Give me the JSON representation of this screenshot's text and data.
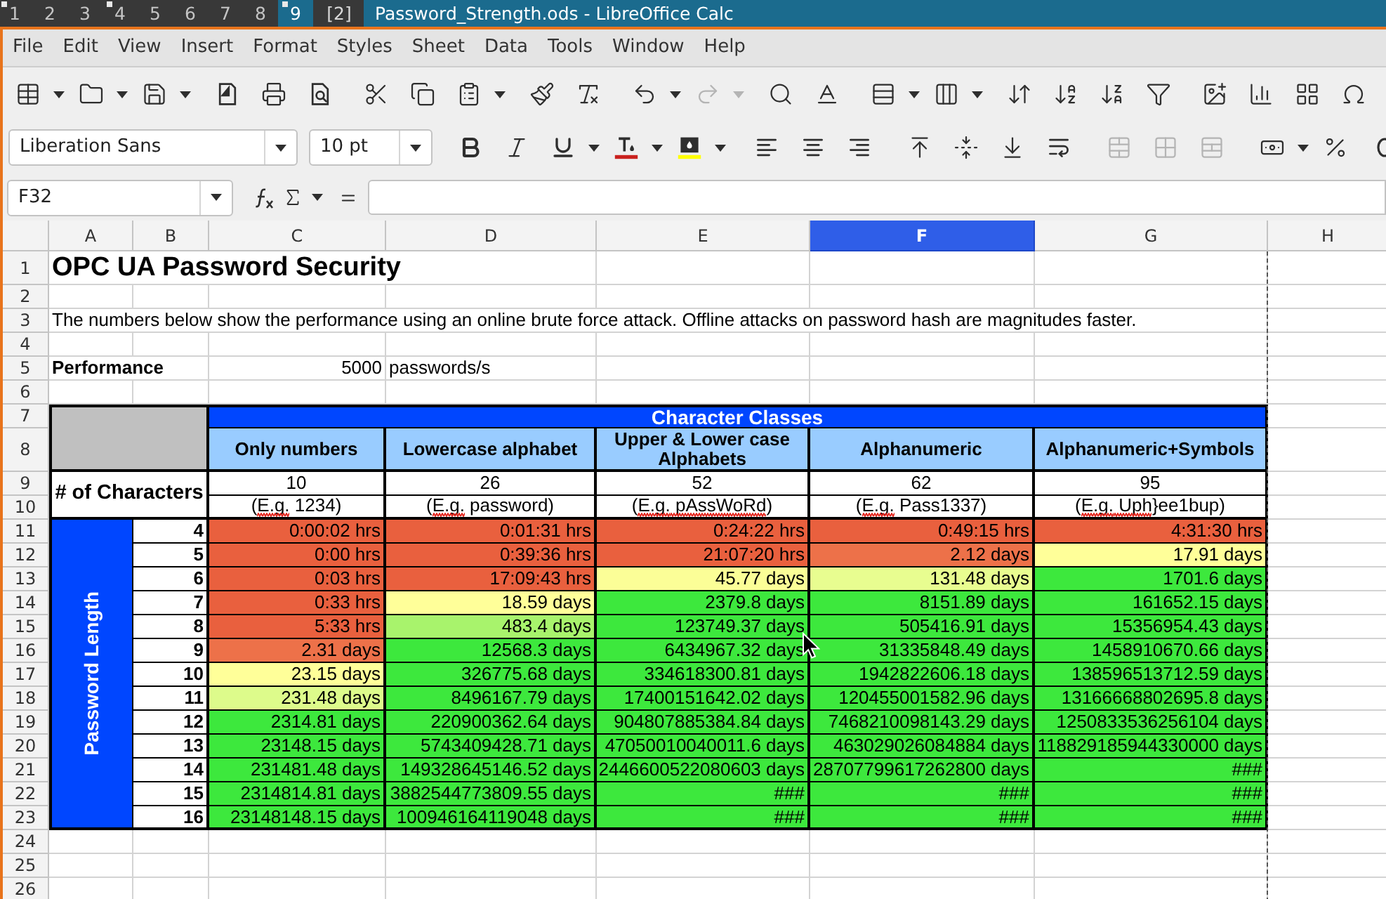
{
  "desktop_bar": {
    "workspaces": [
      {
        "label": "1",
        "selected": false,
        "occupied": true
      },
      {
        "label": "2",
        "selected": false,
        "occupied": false
      },
      {
        "label": "3",
        "selected": false,
        "occupied": false
      },
      {
        "label": "4",
        "selected": false,
        "occupied": true
      },
      {
        "label": "5",
        "selected": false,
        "occupied": false
      },
      {
        "label": "6",
        "selected": false,
        "occupied": false
      },
      {
        "label": "7",
        "selected": false,
        "occupied": false
      },
      {
        "label": "8",
        "selected": false,
        "occupied": false
      },
      {
        "label": "9",
        "selected": true,
        "occupied": true
      }
    ],
    "status": "[2]",
    "window_title": "Password_Strength.ods - LibreOffice Calc"
  },
  "menu": [
    "File",
    "Edit",
    "View",
    "Insert",
    "Format",
    "Styles",
    "Sheet",
    "Data",
    "Tools",
    "Window",
    "Help"
  ],
  "standard_toolbar": [
    [
      {
        "kind": "table",
        "dropdown": true,
        "disabled": false
      },
      {
        "kind": "folder",
        "dropdown": true,
        "disabled": false
      },
      {
        "kind": "save",
        "dropdown": true,
        "disabled": false
      }
    ],
    [
      {
        "kind": "export",
        "dropdown": false,
        "disabled": false
      },
      {
        "kind": "printer",
        "dropdown": false,
        "disabled": false
      },
      {
        "kind": "preview",
        "dropdown": false,
        "disabled": false
      }
    ],
    [
      {
        "kind": "cut",
        "dropdown": false,
        "disabled": false
      },
      {
        "kind": "copy",
        "dropdown": false,
        "disabled": false
      },
      {
        "kind": "paste",
        "dropdown": true,
        "disabled": false
      }
    ],
    [
      {
        "kind": "brush",
        "dropdown": false,
        "disabled": false
      },
      {
        "kind": "unformat",
        "dropdown": false,
        "disabled": false
      }
    ],
    [
      {
        "kind": "undo",
        "dropdown": true,
        "disabled": false
      },
      {
        "kind": "redo",
        "dropdown": true,
        "disabled": true
      }
    ],
    [
      {
        "kind": "find",
        "dropdown": false,
        "disabled": false
      },
      {
        "kind": "spelling",
        "dropdown": false,
        "disabled": false
      }
    ],
    [
      {
        "kind": "rows",
        "dropdown": true,
        "disabled": false
      },
      {
        "kind": "columns",
        "dropdown": true,
        "disabled": false
      }
    ],
    [
      {
        "kind": "sort",
        "dropdown": false,
        "disabled": false
      },
      {
        "kind": "ascending",
        "dropdown": false,
        "disabled": false
      },
      {
        "kind": "descending",
        "dropdown": false,
        "disabled": false
      },
      {
        "kind": "filter",
        "dropdown": false,
        "disabled": false
      }
    ],
    [
      {
        "kind": "image",
        "dropdown": false,
        "disabled": false
      },
      {
        "kind": "chart",
        "dropdown": false,
        "disabled": false
      },
      {
        "kind": "pivot",
        "dropdown": false,
        "disabled": false
      },
      {
        "kind": "symbol",
        "dropdown": false,
        "disabled": false
      }
    ]
  ],
  "formatting_toolbar": {
    "font_name": "Liberation Sans",
    "font_size": "10 pt",
    "groups": [
      [
        {
          "kind": "bold",
          "dropdown": false,
          "disabled": false
        },
        {
          "kind": "italic",
          "dropdown": false,
          "disabled": false
        },
        {
          "kind": "underline",
          "dropdown": true,
          "disabled": false
        },
        {
          "kind": "fontcolor",
          "dropdown": true,
          "disabled": false
        },
        {
          "kind": "highlight",
          "dropdown": true,
          "disabled": false
        }
      ],
      [
        {
          "kind": "left",
          "dropdown": false,
          "disabled": false
        },
        {
          "kind": "center",
          "dropdown": false,
          "disabled": false
        },
        {
          "kind": "right",
          "dropdown": false,
          "disabled": false
        }
      ],
      [
        {
          "kind": "top",
          "dropdown": false,
          "disabled": false
        },
        {
          "kind": "middle",
          "dropdown": false,
          "disabled": false
        },
        {
          "kind": "bottom",
          "dropdown": false,
          "disabled": false
        },
        {
          "kind": "wrap",
          "dropdown": false,
          "disabled": false
        }
      ],
      [
        {
          "kind": "merge",
          "dropdown": false,
          "disabled": true
        },
        {
          "kind": "mergecenter",
          "dropdown": false,
          "disabled": true
        },
        {
          "kind": "unmerge",
          "dropdown": false,
          "disabled": true
        }
      ],
      [
        {
          "kind": "currency",
          "dropdown": true,
          "disabled": false
        },
        {
          "kind": "percent",
          "dropdown": false,
          "disabled": false
        },
        {
          "kind": "decimal",
          "dropdown": false,
          "disabled": false
        }
      ]
    ]
  },
  "formula_bar": {
    "name_box": "F32"
  },
  "sheet": {
    "columns": [
      {
        "label": "A",
        "selected": false
      },
      {
        "label": "B",
        "selected": false
      },
      {
        "label": "C",
        "selected": false
      },
      {
        "label": "D",
        "selected": false
      },
      {
        "label": "E",
        "selected": false
      },
      {
        "label": "F",
        "selected": true
      },
      {
        "label": "G",
        "selected": false
      },
      {
        "label": "H",
        "selected": false
      }
    ],
    "rows": [
      "1",
      "2",
      "3",
      "4",
      "5",
      "6",
      "7",
      "8",
      "9",
      "10",
      "11",
      "12",
      "13",
      "14",
      "15",
      "16",
      "17",
      "18",
      "19",
      "20",
      "21",
      "22",
      "23",
      "24",
      "25",
      "26"
    ],
    "title": "OPC UA Password Security",
    "note": "The numbers below show the performance using an online brute force attack. Offline attacks on password hash are magnitudes faster.",
    "performance": {
      "label": "Performance",
      "value": "5000",
      "unit": "passwords/s"
    },
    "table": {
      "group_header": "Character Classes",
      "row_heading": "# of Characters",
      "side_label": "Password Length",
      "classes": [
        {
          "name": "Only numbers",
          "count": "10",
          "example": [
            {
              "text": "(",
              "misspelled": false
            },
            {
              "text": "E.g.",
              "misspelled": true
            },
            {
              "text": " 1234)",
              "misspelled": false
            }
          ]
        },
        {
          "name": "Lowercase alphabet",
          "count": "26",
          "example": [
            {
              "text": "(",
              "misspelled": false
            },
            {
              "text": "E.g.",
              "misspelled": true
            },
            {
              "text": " password)",
              "misspelled": false
            }
          ]
        },
        {
          "name": "Upper & Lower case Alphabets",
          "count": "52",
          "example": [
            {
              "text": "(",
              "misspelled": false
            },
            {
              "text": "E.g.",
              "misspelled": true
            },
            {
              "text": " pAssWoRd",
              "misspelled": true
            },
            {
              "text": ")",
              "misspelled": false
            }
          ]
        },
        {
          "name": "Alphanumeric",
          "count": "62",
          "example": [
            {
              "text": "(",
              "misspelled": false
            },
            {
              "text": "E.g.",
              "misspelled": true
            },
            {
              "text": " Pass1337)",
              "misspelled": false
            }
          ]
        },
        {
          "name": "Alphanumeric+Symbols",
          "count": "95",
          "example": [
            {
              "text": "(",
              "misspelled": false
            },
            {
              "text": "E.g.",
              "misspelled": true
            },
            {
              "text": " Uph",
              "misspelled": true
            },
            {
              "text": "}ee1bup)",
              "misspelled": false
            }
          ]
        }
      ],
      "rows": [
        {
          "length": "4",
          "cells": [
            {
              "text": "0:00:02 hrs",
              "color": "#e9603e"
            },
            {
              "text": "0:01:31 hrs",
              "color": "#e9603e"
            },
            {
              "text": "0:24:22 hrs",
              "color": "#e9603e"
            },
            {
              "text": "0:49:15 hrs",
              "color": "#e9603e"
            },
            {
              "text": "4:31:30 hrs",
              "color": "#e9603e"
            }
          ]
        },
        {
          "length": "5",
          "cells": [
            {
              "text": "0:00 hrs",
              "color": "#e9603e"
            },
            {
              "text": "0:39:36 hrs",
              "color": "#e9603e"
            },
            {
              "text": "21:07:20 hrs",
              "color": "#e9603e"
            },
            {
              "text": "2.12 days",
              "color": "#ed7149"
            },
            {
              "text": "17.91 days",
              "color": "#ffff99"
            }
          ]
        },
        {
          "length": "6",
          "cells": [
            {
              "text": "0:03 hrs",
              "color": "#e9603e"
            },
            {
              "text": "17:09:43 hrs",
              "color": "#e9603e"
            },
            {
              "text": "45.77 days",
              "color": "#fbfe97"
            },
            {
              "text": "131.48 days",
              "color": "#e8fd90"
            },
            {
              "text": "1701.6 days",
              "color": "#3de83d"
            }
          ]
        },
        {
          "length": "7",
          "cells": [
            {
              "text": "0:33 hrs",
              "color": "#e9603e"
            },
            {
              "text": "18.59 days",
              "color": "#ffff99"
            },
            {
              "text": "2379.8 days",
              "color": "#3de83d"
            },
            {
              "text": "8151.89 days",
              "color": "#3de83d"
            },
            {
              "text": "161652.15 days",
              "color": "#3de83d"
            }
          ]
        },
        {
          "length": "8",
          "cells": [
            {
              "text": "5:33 hrs",
              "color": "#e9603e"
            },
            {
              "text": "483.4 days",
              "color": "#a8f36c"
            },
            {
              "text": "123749.37 days",
              "color": "#3de83d"
            },
            {
              "text": "505416.91 days",
              "color": "#3de83d"
            },
            {
              "text": "15356954.43 days",
              "color": "#3de83d"
            }
          ]
        },
        {
          "length": "9",
          "cells": [
            {
              "text": "2.31 days",
              "color": "#ed7149"
            },
            {
              "text": "12568.3 days",
              "color": "#3de83d"
            },
            {
              "text": "6434967.32 days",
              "color": "#3de83d"
            },
            {
              "text": "31335848.49 days",
              "color": "#3de83d"
            },
            {
              "text": "1458910670.66 days",
              "color": "#3de83d"
            }
          ]
        },
        {
          "length": "10",
          "cells": [
            {
              "text": "23.15 days",
              "color": "#ffff99"
            },
            {
              "text": "326775.68 days",
              "color": "#3de83d"
            },
            {
              "text": "334618300.81 days",
              "color": "#3de83d"
            },
            {
              "text": "1942822606.18 days",
              "color": "#3de83d"
            },
            {
              "text": "138596513712.59 days",
              "color": "#3de83d"
            }
          ]
        },
        {
          "length": "11",
          "cells": [
            {
              "text": "231.48 days",
              "color": "#ddfb8b"
            },
            {
              "text": "8496167.79 days",
              "color": "#3de83d"
            },
            {
              "text": "17400151642.02 days",
              "color": "#3de83d"
            },
            {
              "text": "120455001582.96 days",
              "color": "#3de83d"
            },
            {
              "text": "13166668802695.8 days",
              "color": "#3de83d"
            }
          ]
        },
        {
          "length": "12",
          "cells": [
            {
              "text": "2314.81 days",
              "color": "#3de83d"
            },
            {
              "text": "220900362.64 days",
              "color": "#3de83d"
            },
            {
              "text": "904807885384.84 days",
              "color": "#3de83d"
            },
            {
              "text": "7468210098143.29 days",
              "color": "#3de83d"
            },
            {
              "text": "1250833536256104 days",
              "color": "#3de83d"
            }
          ]
        },
        {
          "length": "13",
          "cells": [
            {
              "text": "23148.15 days",
              "color": "#3de83d"
            },
            {
              "text": "5743409428.71 days",
              "color": "#3de83d"
            },
            {
              "text": "47050010040011.6 days",
              "color": "#3de83d"
            },
            {
              "text": "463029026084884 days",
              "color": "#3de83d"
            },
            {
              "text": "118829185944330000 days",
              "color": "#3de83d"
            }
          ]
        },
        {
          "length": "14",
          "cells": [
            {
              "text": "231481.48 days",
              "color": "#3de83d"
            },
            {
              "text": "149328645146.52 days",
              "color": "#3de83d"
            },
            {
              "text": "2446600522080603 days",
              "color": "#3de83d"
            },
            {
              "text": "28707799617262800 days",
              "color": "#3de83d"
            },
            {
              "text": "###",
              "color": "#3de83d"
            }
          ]
        },
        {
          "length": "15",
          "cells": [
            {
              "text": "2314814.81 days",
              "color": "#3de83d"
            },
            {
              "text": "3882544773809.55 days",
              "color": "#3de83d"
            },
            {
              "text": "###",
              "color": "#3de83d"
            },
            {
              "text": "###",
              "color": "#3de83d"
            },
            {
              "text": "###",
              "color": "#3de83d"
            }
          ]
        },
        {
          "length": "16",
          "cells": [
            {
              "text": "23148148.15 days",
              "color": "#3de83d"
            },
            {
              "text": "100946164119048 days",
              "color": "#3de83d"
            },
            {
              "text": "###",
              "color": "#3de83d"
            },
            {
              "text": "###",
              "color": "#3de83d"
            },
            {
              "text": "###",
              "color": "#3de83d"
            }
          ]
        }
      ]
    }
  }
}
